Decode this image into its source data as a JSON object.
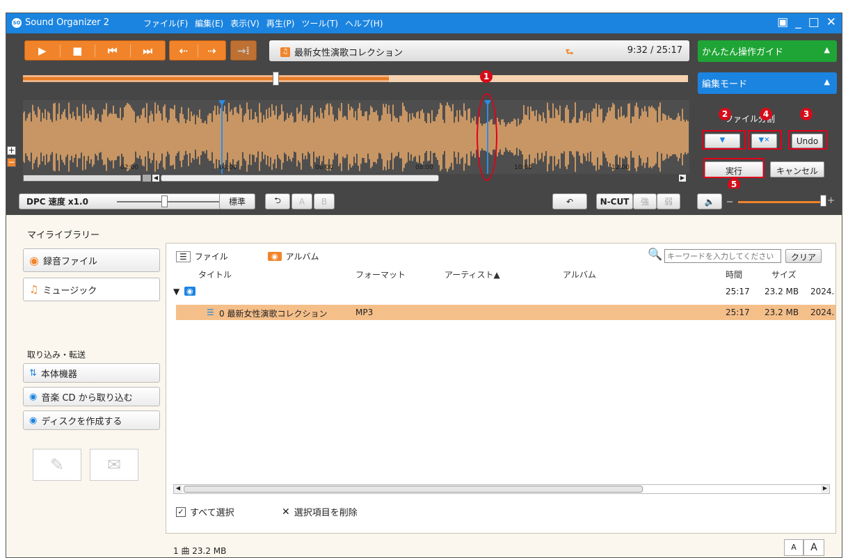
{
  "app": {
    "title": "Sound Organizer 2",
    "logo": "SO"
  },
  "menu": [
    "ファイル(F)",
    "編集(E)",
    "表示(V)",
    "再生(P)",
    "ツール(T)",
    "ヘルプ(H)"
  ],
  "window_controls": [
    "▣",
    "_",
    "□",
    "✕"
  ],
  "player": {
    "play": "▶",
    "stop": "■",
    "prev": "⏮",
    "next": "⏭",
    "rew": "⇠",
    "fwd": "⇢",
    "abrepeat": "→⁞",
    "track": "最新女性演歌コレクション",
    "time": "9:32 / 25:17",
    "note_icon": "♫",
    "loop_icon": "⮑"
  },
  "guide": {
    "label": "かんたん操作ガイド",
    "arrow": "▲",
    "color": "#1fa535"
  },
  "editmode": {
    "label": "編集モード",
    "arrow": "▲",
    "color": "#1b84e0"
  },
  "progress": {
    "position_fraction": 0.38,
    "buffered_fraction": 0.55
  },
  "wave": {
    "ticks": [
      "02:00",
      "04:00",
      "06:00",
      "08:00",
      "10:00",
      "12:00"
    ],
    "markers": [
      "marker-1",
      "marker-2"
    ]
  },
  "edit": {
    "title": "ファイル分割",
    "add_marker": "▼",
    "del_marker": "▼✕",
    "undo": "Undo",
    "execute": "実行",
    "cancel": "キャンセル"
  },
  "callouts": [
    "1",
    "2",
    "3",
    "4",
    "5"
  ],
  "dpc": {
    "label": "DPC 速度 x1.0",
    "standard": "標準",
    "a": "A",
    "b": "B",
    "ncut": "N-CUT",
    "strong": "強",
    "weak": "弱",
    "volume_fraction": 0.95
  },
  "library": {
    "title": "マイライブラリー",
    "rec": "録音ファイル",
    "music": "ミュージック",
    "import_title": "取り込み・転送",
    "device": "本体機器",
    "cd": "音楽 CD から取り込む",
    "disc": "ディスクを作成する"
  },
  "panel": {
    "file_tab": "ファイル",
    "album_tab": "アルバム",
    "search_placeholder": "キーワードを入力してください",
    "clear": "クリア",
    "columns": [
      "タイトル",
      "フォーマット",
      "アーティスト▲",
      "アルバム",
      "時間",
      "サイズ"
    ],
    "group": {
      "time": "25:17",
      "size": "23.2 MB",
      "date": "2024."
    },
    "rows": [
      {
        "title": "0 最新女性演歌コレクション",
        "format": "MP3",
        "time": "25:17",
        "size": "23.2 MB",
        "date": "2024."
      }
    ],
    "select_all": "すべて選択",
    "delete_selected": "選択項目を削除"
  },
  "status": {
    "summary": "1 曲 23.2 MB",
    "font_small": "A",
    "font_large": "A"
  }
}
